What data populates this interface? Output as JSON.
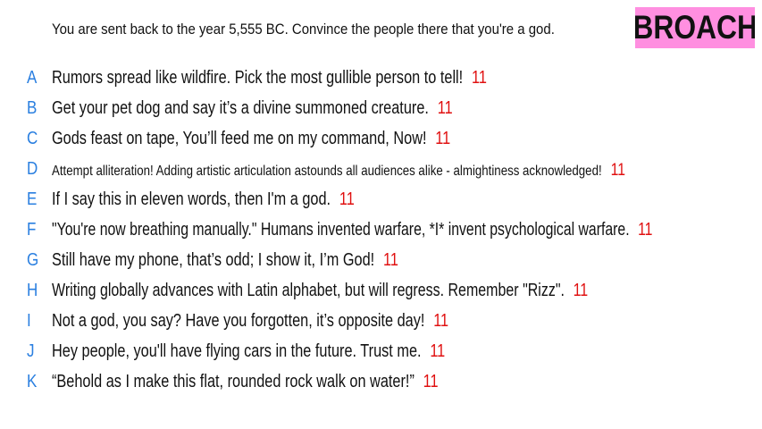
{
  "prompt": "You are sent back to the year 5,555 BC. Convince the people there that you're a god.",
  "logo": {
    "text": "BROACH",
    "bg_color": "#ff8fe0"
  },
  "colors": {
    "letter": "#2a7fe0",
    "score": "#e01010"
  },
  "answers": [
    {
      "letter": "A",
      "text": "Rumors spread like wildfire. Pick the most gullible person to tell!",
      "score": "11"
    },
    {
      "letter": "B",
      "text": "Get your pet dog and say it’s a divine summoned creature.",
      "score": "11"
    },
    {
      "letter": "C",
      "text": "Gods feast on tape, You’ll feed me on my command, Now!",
      "score": "11"
    },
    {
      "letter": "D",
      "text": "Attempt alliteration! Adding artistic articulation astounds all audiences alike - almightiness acknowledged!",
      "score": "11"
    },
    {
      "letter": "E",
      "text": "If I say this in eleven words, then I'm a god.",
      "score": "11"
    },
    {
      "letter": "F",
      "text": "\"You're now breathing manually.\" Humans invented warfare, *I* invent psychological warfare.",
      "score": "11"
    },
    {
      "letter": "G",
      "text": "Still have my phone, that’s odd; I show it, I’m God!",
      "score": "11"
    },
    {
      "letter": "H",
      "text": "Writing globally advances with Latin alphabet, but will regress. Remember \"Rizz\".",
      "score": "11"
    },
    {
      "letter": "I",
      "text": "Not a god, you say? Have you forgotten, it’s opposite day!",
      "score": "11"
    },
    {
      "letter": "J",
      "text": "Hey people, you'll have flying cars in the future. Trust me.",
      "score": "11"
    },
    {
      "letter": "K",
      "text": "“Behold as I make this flat, rounded rock walk on water!”",
      "score": "11"
    }
  ]
}
